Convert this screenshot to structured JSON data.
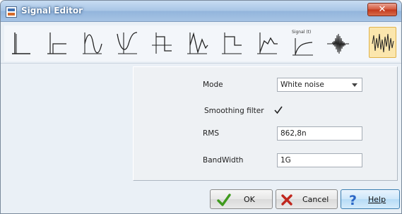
{
  "window": {
    "title": "Signal Editor",
    "close_label": "✕"
  },
  "toolbar": {
    "tools": [
      {
        "name": "step-signal-icon"
      },
      {
        "name": "delayed-step-signal-icon"
      },
      {
        "name": "sine-wave-icon"
      },
      {
        "name": "inverted-sine-wave-icon"
      },
      {
        "name": "square-pulse-icon"
      },
      {
        "name": "damped-wave-icon"
      },
      {
        "name": "rectangular-pulse-icon"
      },
      {
        "name": "piecewise-linear-icon"
      },
      {
        "name": "custom-signal-function-icon",
        "label": "Signal (t)"
      },
      {
        "name": "burst-signal-icon"
      },
      {
        "name": "white-noise-icon",
        "selected": true
      }
    ]
  },
  "form": {
    "mode": {
      "label": "Mode",
      "value": "White noise"
    },
    "smoothing": {
      "label": "Smoothing filter",
      "checked": true
    },
    "rms": {
      "label": "RMS",
      "value": "862,8n"
    },
    "bandwidth": {
      "label": "BandWidth",
      "value": "1G"
    }
  },
  "buttons": {
    "ok": "OK",
    "cancel": "Cancel",
    "help": "Help"
  },
  "colors": {
    "ok_check": "#3f9a1e",
    "cancel_x": "#c0261d",
    "help_icon": "#2a66c6",
    "selected_tool": "#fbe6ad"
  }
}
